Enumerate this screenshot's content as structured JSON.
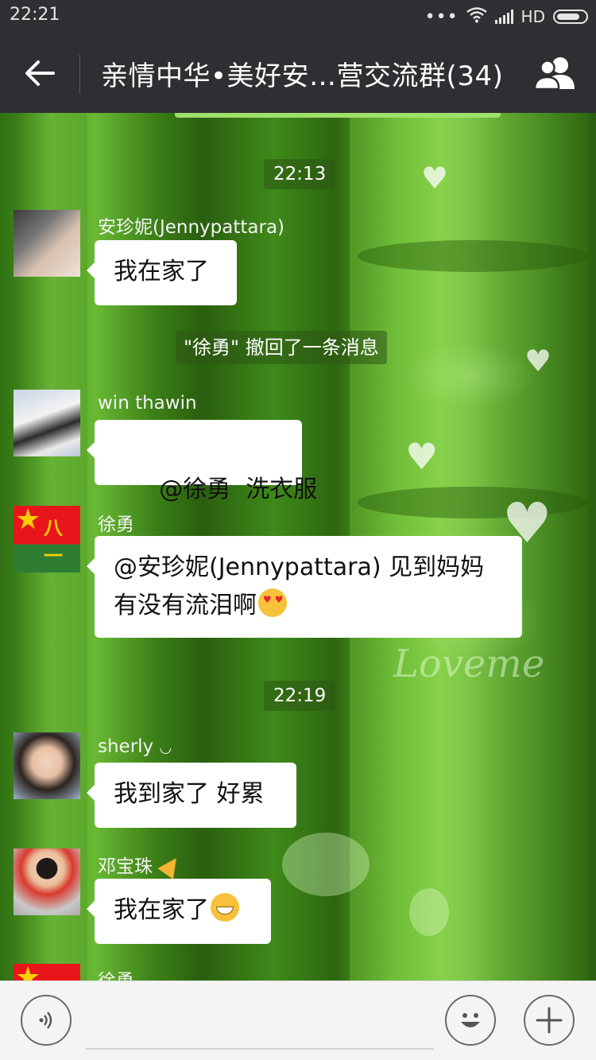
{
  "status_bar": {
    "time": "22:21",
    "network": "HD",
    "icons": [
      "more-dots-icon",
      "wifi-icon",
      "signal-icon",
      "battery-icon"
    ]
  },
  "nav": {
    "title": "亲情中华•美好安…营交流群(34)",
    "back_icon": "back-arrow-icon",
    "members_icon": "group-members-icon"
  },
  "chat": {
    "timestamps": [
      "22:13",
      "22:19"
    ],
    "system_message": "\"徐勇\" 撤回了一条消息",
    "messages": [
      {
        "sender": "安珍妮(Jennypattara)",
        "text": "我在家了",
        "avatar": "photo-avatar"
      },
      {
        "sender": "win thawin",
        "text": "@徐勇  洗衣服",
        "avatar": "photo-avatar"
      },
      {
        "sender": "徐勇",
        "line1": "@安珍妮(Jennypattara) 见到妈妈",
        "line2": "有没有流泪啊",
        "emoji": "heart-eyes-emoji",
        "avatar": "flag-avatar",
        "avatar_text": "八一"
      },
      {
        "sender": "sherly",
        "sender_suffix": "◡",
        "text": "我到家了 好累",
        "avatar": "photo-avatar"
      },
      {
        "sender": "邓宝珠",
        "sender_emoji": "party-popper-emoji",
        "text": "我在家了",
        "emoji": "grinning-emoji",
        "avatar": "photo-avatar"
      },
      {
        "sender": "徐勇",
        "avatar": "flag-avatar"
      }
    ]
  },
  "input_bar": {
    "voice_icon": "voice-icon",
    "emoji_icon": "emoji-face-icon",
    "plus_icon": "plus-icon",
    "placeholder": ""
  },
  "colors": {
    "nav_bg": "#2e2f33",
    "status_bg": "#2f3033",
    "bubble_bg": "#ffffff",
    "chat_bg": "#4f9e24",
    "input_bg": "#f4f4f4"
  }
}
